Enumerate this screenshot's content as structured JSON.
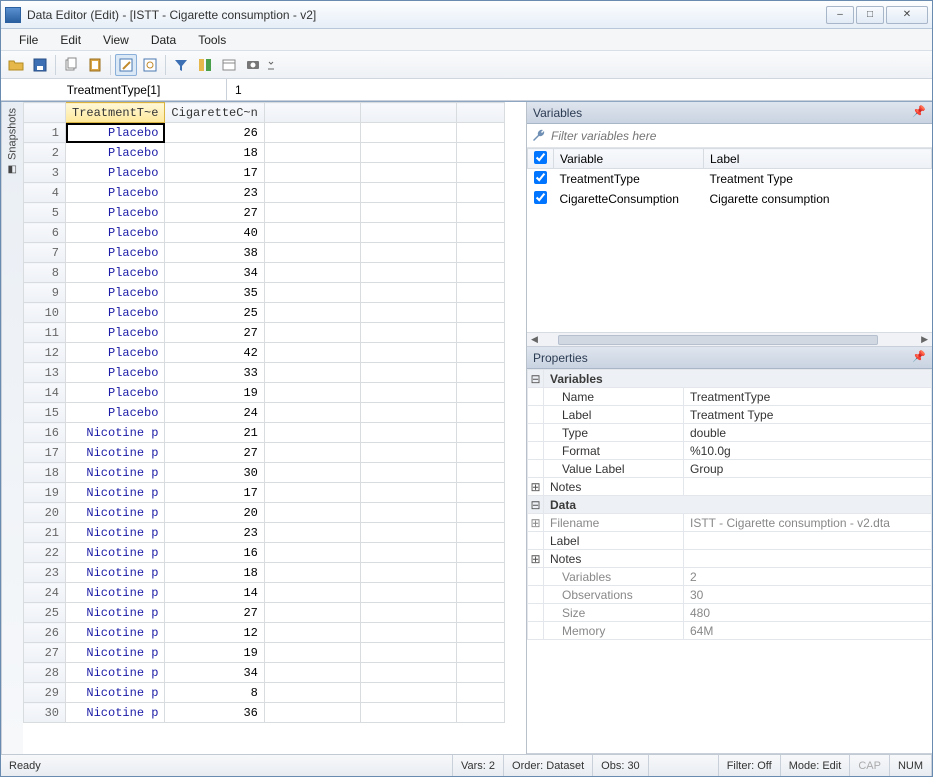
{
  "window": {
    "title": "Data Editor (Edit) - [ISTT - Cigarette consumption - v2]"
  },
  "menu": [
    "File",
    "Edit",
    "View",
    "Data",
    "Tools"
  ],
  "formula": {
    "cell_name": "TreatmentType[1]",
    "cell_value": "1"
  },
  "snapshots_rail": "Snapshots",
  "grid": {
    "columns": [
      "TreatmentT~e",
      "CigaretteC~n"
    ],
    "rows": [
      {
        "n": 1,
        "t": "Placebo",
        "c": 26
      },
      {
        "n": 2,
        "t": "Placebo",
        "c": 18
      },
      {
        "n": 3,
        "t": "Placebo",
        "c": 17
      },
      {
        "n": 4,
        "t": "Placebo",
        "c": 23
      },
      {
        "n": 5,
        "t": "Placebo",
        "c": 27
      },
      {
        "n": 6,
        "t": "Placebo",
        "c": 40
      },
      {
        "n": 7,
        "t": "Placebo",
        "c": 38
      },
      {
        "n": 8,
        "t": "Placebo",
        "c": 34
      },
      {
        "n": 9,
        "t": "Placebo",
        "c": 35
      },
      {
        "n": 10,
        "t": "Placebo",
        "c": 25
      },
      {
        "n": 11,
        "t": "Placebo",
        "c": 27
      },
      {
        "n": 12,
        "t": "Placebo",
        "c": 42
      },
      {
        "n": 13,
        "t": "Placebo",
        "c": 33
      },
      {
        "n": 14,
        "t": "Placebo",
        "c": 19
      },
      {
        "n": 15,
        "t": "Placebo",
        "c": 24
      },
      {
        "n": 16,
        "t": "Nicotine p",
        "c": 21
      },
      {
        "n": 17,
        "t": "Nicotine p",
        "c": 27
      },
      {
        "n": 18,
        "t": "Nicotine p",
        "c": 30
      },
      {
        "n": 19,
        "t": "Nicotine p",
        "c": 17
      },
      {
        "n": 20,
        "t": "Nicotine p",
        "c": 20
      },
      {
        "n": 21,
        "t": "Nicotine p",
        "c": 23
      },
      {
        "n": 22,
        "t": "Nicotine p",
        "c": 16
      },
      {
        "n": 23,
        "t": "Nicotine p",
        "c": 18
      },
      {
        "n": 24,
        "t": "Nicotine p",
        "c": 14
      },
      {
        "n": 25,
        "t": "Nicotine p",
        "c": 27
      },
      {
        "n": 26,
        "t": "Nicotine p",
        "c": 12
      },
      {
        "n": 27,
        "t": "Nicotine p",
        "c": 19
      },
      {
        "n": 28,
        "t": "Nicotine p",
        "c": 34
      },
      {
        "n": 29,
        "t": "Nicotine p",
        "c": 8
      },
      {
        "n": 30,
        "t": "Nicotine p",
        "c": 36
      }
    ],
    "selected": {
      "row": 1,
      "col": 0
    }
  },
  "variables_pane": {
    "title": "Variables",
    "filter_placeholder": "Filter variables here",
    "headers": {
      "check": "",
      "variable": "Variable",
      "label": "Label"
    },
    "rows": [
      {
        "checked": true,
        "variable": "TreatmentType",
        "label": "Treatment Type"
      },
      {
        "checked": true,
        "variable": "CigaretteConsumption",
        "label": "Cigarette consumption"
      }
    ]
  },
  "properties_pane": {
    "title": "Properties",
    "sections": {
      "variables_header": "Variables",
      "name_label": "Name",
      "name_value": "TreatmentType",
      "label_label": "Label",
      "label_value": "Treatment Type",
      "type_label": "Type",
      "type_value": "double",
      "format_label": "Format",
      "format_value": "%10.0g",
      "valuelabel_label": "Value Label",
      "valuelabel_value": "Group",
      "notes_label": "Notes",
      "data_header": "Data",
      "filename_label": "Filename",
      "filename_value": "ISTT - Cigarette consumption - v2.dta",
      "data_label_label": "Label",
      "data_label_value": "",
      "data_notes_label": "Notes",
      "vars_label": "Variables",
      "vars_value": "2",
      "obs_label": "Observations",
      "obs_value": "30",
      "size_label": "Size",
      "size_value": "480",
      "memory_label": "Memory",
      "memory_value": "64M"
    }
  },
  "status": {
    "ready": "Ready",
    "vars": "Vars: 2",
    "order": "Order: Dataset",
    "obs": "Obs: 30",
    "filter": "Filter: Off",
    "mode": "Mode: Edit",
    "cap": "CAP",
    "num": "NUM"
  }
}
